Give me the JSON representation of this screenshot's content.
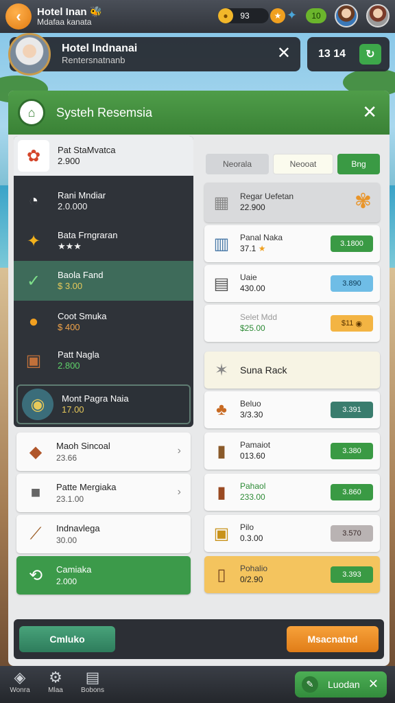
{
  "topbar": {
    "back_icon": "back-arrow-icon",
    "title": "Hotel Inan",
    "title_suffix": "🐝",
    "subtitle": "Mdafaa kanata",
    "coins": "93",
    "gems": "10"
  },
  "hotel": {
    "name": "Hotel Indnanai",
    "subtitle": "Rentersnatnanb",
    "timer": "13 14"
  },
  "panel": {
    "title": "Systeh Resemsia"
  },
  "left_list": [
    {
      "name": "Pat StaMvatca",
      "value": "2.900",
      "icon": "flower-icon",
      "style": "first"
    },
    {
      "name": "Rani Mndiar",
      "value": "2.0.000",
      "icon": "toilet-icon",
      "style": "normal"
    },
    {
      "name": "Bata Frngraran",
      "value": "★★★",
      "icon": "star-icon",
      "style": "stars"
    },
    {
      "name": "Baola Fand",
      "value": "$ 3.00",
      "icon": "broom-icon",
      "style": "selected"
    },
    {
      "name": "Coot Smuka",
      "value": "$ 400",
      "icon": "pin-icon",
      "style": "orange"
    },
    {
      "name": "Patt Nagla",
      "value": "2.800",
      "icon": "food-basket-icon",
      "style": "green"
    },
    {
      "name": "Mont Pagra Naia",
      "value": "17.00",
      "icon": "badge-icon",
      "style": "gold"
    }
  ],
  "left_cards": [
    {
      "name": "Maoh Sincoal",
      "value": "23.66",
      "icon": "tray-icon",
      "arrow": true
    },
    {
      "name": "Patte Mergiaka",
      "value": "23.1.00",
      "icon": "cube-icon",
      "arrow": true
    },
    {
      "name": "Indnavlega",
      "value": "30.00",
      "icon": "brush-icon",
      "arrow": false
    },
    {
      "name": "Camiaka",
      "value": "2.000",
      "icon": "cleaning-icon",
      "arrow": false,
      "green": true
    }
  ],
  "filters": [
    "Neorala",
    "Neooat",
    "Bng"
  ],
  "right_cards": [
    {
      "name": "Regar Uefetan",
      "value": "22.900",
      "icon": "box-icon",
      "style": "head",
      "price": ""
    },
    {
      "name": "Panal Naka",
      "value": "37.1",
      "icon": "building-icon",
      "style": "normal",
      "price": "3.1800",
      "price_color": "#3a9a44"
    },
    {
      "name": "Uaie",
      "value": "430.00",
      "icon": "locker-icon",
      "style": "normal",
      "price": "3.890",
      "price_color": "#4aa6d9"
    },
    {
      "name": "Selet Mdd",
      "value": "$25.00",
      "icon": "",
      "style": "normal",
      "price": "$11",
      "price_color": "#f0a83a"
    },
    {
      "name": "Suna Rack",
      "value": "",
      "icon": "sparkle-icon",
      "style": "section",
      "price": ""
    },
    {
      "name": "Beluo",
      "value": "3/3.30",
      "icon": "fruit-icon",
      "style": "normal",
      "price": "3.391",
      "price_color": "#3a7d6e"
    },
    {
      "name": "Pamaiot",
      "value": "013.60",
      "icon": "cabinet-icon",
      "style": "normal",
      "price": "3.380",
      "price_color": "#3a9a44"
    },
    {
      "name": "Pahaol",
      "value": "233.00",
      "icon": "wardrobe-icon",
      "style": "green",
      "price": "3.860",
      "price_color": "#3a9a44"
    },
    {
      "name": "Pilo",
      "value": "0.3.00",
      "icon": "crate-icon",
      "style": "normal",
      "price": "3.570",
      "price_color": "#8a8585"
    },
    {
      "name": "Pohalio",
      "value": "0/2.90",
      "icon": "door-icon",
      "style": "highlight",
      "price": "3.393",
      "price_color": "#3a9a44"
    }
  ],
  "actions": {
    "left": "Cmluko",
    "right": "Msacnatnd"
  },
  "nav": {
    "items": [
      {
        "label": "Wonra",
        "icon": "layers-icon"
      },
      {
        "label": "Mlaa",
        "icon": "gear-icon"
      },
      {
        "label": "Bobons",
        "icon": "chest-icon"
      }
    ],
    "cta_label": "Luodan"
  }
}
